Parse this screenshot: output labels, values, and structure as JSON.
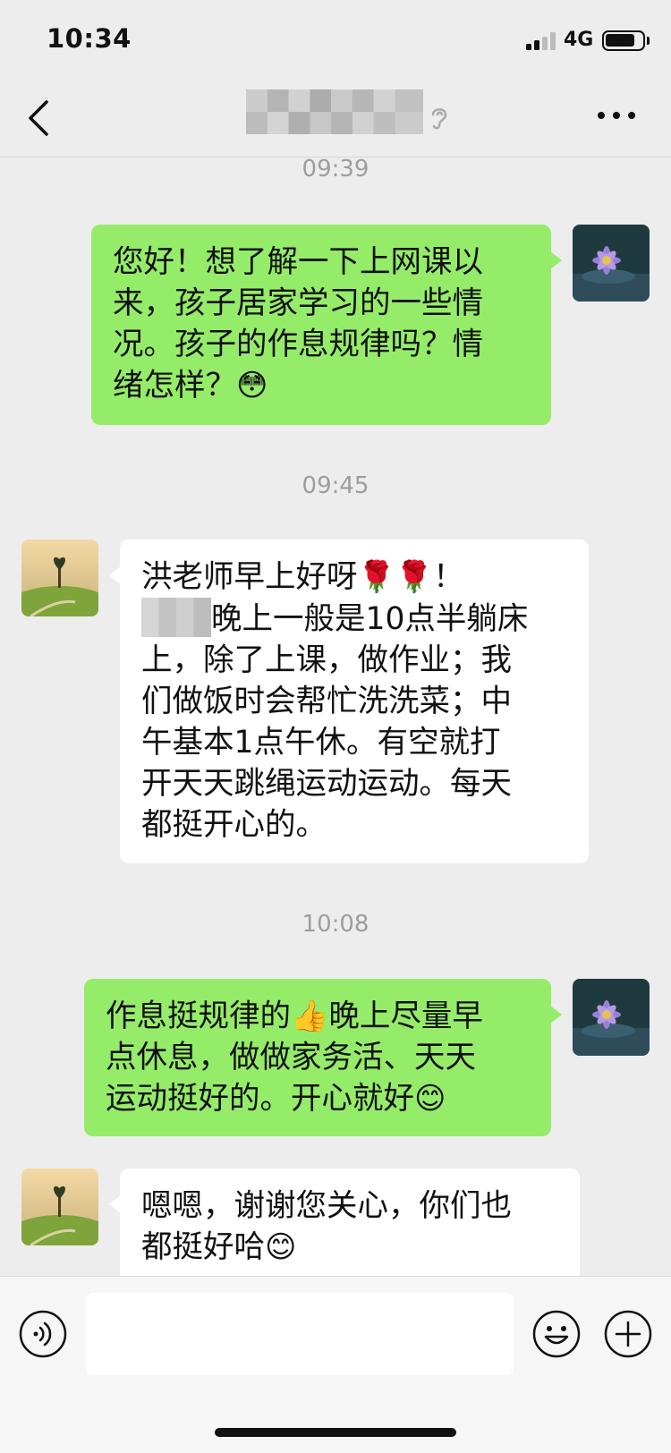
{
  "status_bar": {
    "time": "10:34",
    "network": "4G",
    "icons": [
      "signal-icon",
      "battery-icon"
    ]
  },
  "nav": {
    "back_icon": "chevron-left-icon",
    "title_icon": "ear-icon",
    "more_icon": "more-icon"
  },
  "messages": [
    {
      "type": "time",
      "text": "09:39"
    },
    {
      "type": "sent",
      "avatar": "flower-avatar",
      "lines": [
        "您好！想了解一下上网课以",
        "来，孩子居家学习的一些情",
        "况。孩子的作息规律吗？情",
        "绪怎样？"
      ],
      "emoji": "😳"
    },
    {
      "type": "time",
      "text": "09:45"
    },
    {
      "type": "received",
      "avatar": "landscape-avatar",
      "line1": "洪老师早上好呀",
      "line1_emoji": "🌹🌹",
      "line1_end": "！",
      "line2": "晚上一般是10点半躺床",
      "lines": [
        "上，除了上课，做作业；我",
        "们做饭时会帮忙洗洗菜；中",
        "午基本1点午休。有空就打",
        "开天天跳绳运动运动。每天",
        "都挺开心的。"
      ]
    },
    {
      "type": "time",
      "text": "10:08"
    },
    {
      "type": "sent",
      "avatar": "flower-avatar",
      "line1": "作息挺规律的",
      "line1_emoji": "👍",
      "line1_end": "晚上尽量早",
      "line2": "点休息，做做家务活、天天",
      "line3": "运动挺好的。开心就好",
      "line3_emoji": "😊"
    },
    {
      "type": "received",
      "avatar": "landscape-avatar",
      "line1": "嗯嗯，谢谢您关心，你们也",
      "line2": "都挺好哈",
      "line2_emoji": "😊"
    }
  ],
  "input": {
    "value": "",
    "voice_icon": "voice-icon",
    "emoji_icon": "emoji-icon",
    "plus_icon": "plus-icon"
  },
  "colors": {
    "background": "#ededed",
    "sent_bubble": "#95ec69",
    "received_bubble": "#ffffff",
    "time_label": "#9d9d9d"
  }
}
